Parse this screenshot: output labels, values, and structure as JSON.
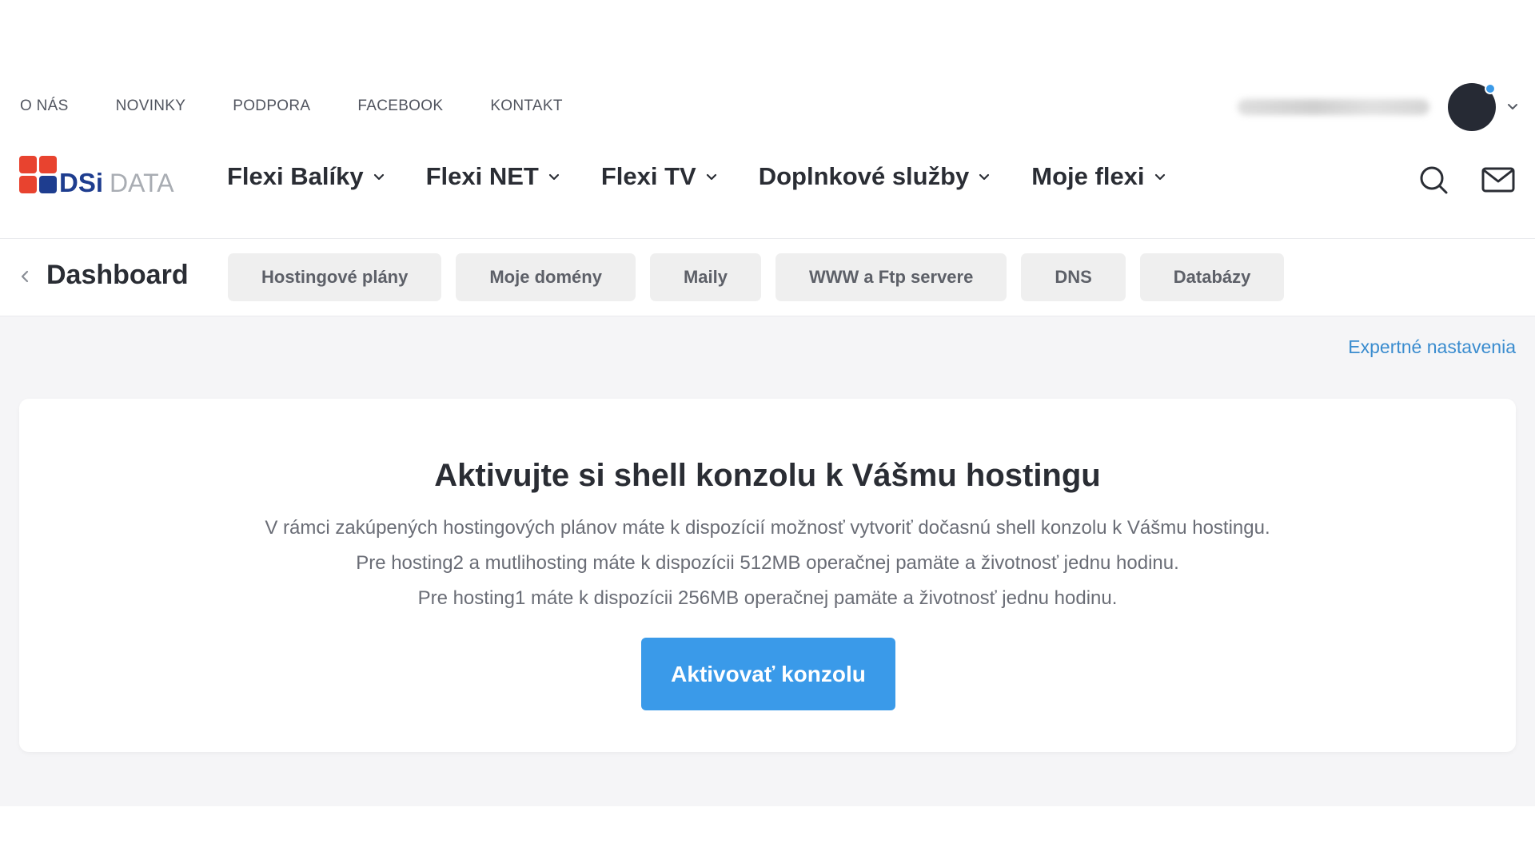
{
  "topbar": {
    "links": [
      "O NÁS",
      "NOVINKY",
      "PODPORA",
      "FACEBOOK",
      "KONTAKT"
    ]
  },
  "brand": {
    "logo_primary": "DSi",
    "logo_secondary": "DATA",
    "colors": {
      "red": "#e8432f",
      "navy": "#1e3d8f",
      "gray": "#a9adb3"
    }
  },
  "mainnav": {
    "items": [
      "Flexi Balíky",
      "Flexi NET",
      "Flexi TV",
      "Doplnkové služby",
      "Moje flexi"
    ]
  },
  "subnav": {
    "title": "Dashboard",
    "tabs": [
      "Hostingové plány",
      "Moje domény",
      "Maily",
      "WWW a Ftp servere",
      "DNS",
      "Databázy"
    ]
  },
  "content": {
    "expert_link": "Expertné nastavenia",
    "card": {
      "title": "Aktivujte si shell konzolu k Vášmu hostingu",
      "lines": [
        "V rámci zakúpených hostingových plánov máte k dispozícií možnosť vytvoriť dočasnú shell konzolu k Vášmu hostingu.",
        "Pre hosting2 a mutlihosting máte k dispozícii 512MB operačnej pamäte a životnosť jednu hodinu.",
        "Pre hosting1  máte k dispozícii 256MB operačnej pamäte a životnosť jednu hodinu."
      ],
      "button": "Aktivovať konzolu"
    }
  },
  "colors": {
    "accent": "#3a9ae9",
    "link": "#3a8ccf",
    "avatar": "#262a34",
    "notification_dot": "#3b9ae8"
  }
}
